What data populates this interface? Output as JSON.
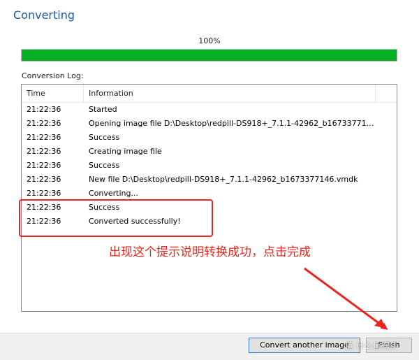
{
  "dialog": {
    "title": "Converting"
  },
  "progress": {
    "label": "100%",
    "value": 100,
    "color": "#06b025"
  },
  "log": {
    "label": "Conversion Log:",
    "columns": {
      "time": "Time",
      "info": "Information"
    },
    "rows": [
      {
        "time": "21:22:36",
        "info": "Started"
      },
      {
        "time": "21:22:36",
        "info": "Opening image file D:\\Desktop\\redpill-DS918+_7.1.1-42962_b16733771..."
      },
      {
        "time": "21:22:36",
        "info": "Success"
      },
      {
        "time": "21:22:36",
        "info": "Creating image file"
      },
      {
        "time": "21:22:36",
        "info": "Success"
      },
      {
        "time": "21:22:36",
        "info": "New file D:\\Desktop\\redpill-DS918+_7.1.1-42962_b1673377146.vmdk"
      },
      {
        "time": "21:22:36",
        "info": "Converting..."
      },
      {
        "time": "21:22:36",
        "info": "Success"
      },
      {
        "time": "21:22:36",
        "info": "Converted successfully!"
      }
    ]
  },
  "annotation": {
    "text": "出现这个提示说明转换成功，点击完成",
    "color": "#e8261e"
  },
  "buttons": {
    "convert_another": "Convert another image",
    "finish": "Finish"
  },
  "watermark": "值 什么值得买"
}
